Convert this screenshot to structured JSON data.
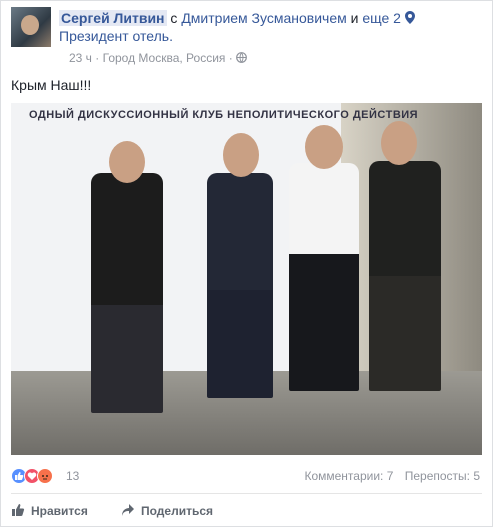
{
  "post": {
    "author": "Сергей Литвин",
    "with_word": "с",
    "tagged_person": "Дмитрием Зусмановичем",
    "and_word": "и",
    "others": "еще 2",
    "location": "Президент отель.",
    "time": "23 ч",
    "separator": "·",
    "place": "Город Москва, Россия",
    "text": "Крым Наш!!!"
  },
  "photo": {
    "banner_title": "ОДНЫЙ ДИСКУССИОННЫЙ КЛУБ НЕПОЛИТИЧЕСКОГО ДЕЙСТВИЯ"
  },
  "footer": {
    "reactions_count": "13",
    "comments": "Комментарии: 7",
    "shares": "Перепосты: 5",
    "like_label": "Нравится",
    "share_label": "Поделиться"
  },
  "colors": {
    "link": "#365899",
    "like": "#5890ff",
    "love": "#f25268",
    "angry": "#f7714b"
  }
}
